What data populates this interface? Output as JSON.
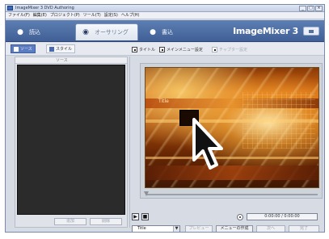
{
  "window": {
    "title": "ImageMixer 3 DVD Authoring",
    "controls": [
      "_",
      "□",
      "×"
    ]
  },
  "menu": [
    "ファイル(F)",
    "編集(E)",
    "プロジェクト(P)",
    "ツール(T)",
    "設定(S)",
    "ヘルプ(H)"
  ],
  "tabs": [
    {
      "label": "読込",
      "icon": "person-icon"
    },
    {
      "label": "オーサリング",
      "icon": "disc-person-icon",
      "active": true
    },
    {
      "label": "書込",
      "icon": "person-icon"
    }
  ],
  "brand": "ImageMixer 3",
  "toolbar": {
    "subtabs": [
      "ソース",
      "スタイル"
    ],
    "buttons": [
      "タイトル",
      "メインメニュー設定",
      "チャプター設定"
    ]
  },
  "left_panel": {
    "header": "ソース",
    "buttons": [
      "追加",
      "削除"
    ]
  },
  "preview": {
    "title_text": "Title"
  },
  "controls": {
    "timecode": "0:00:00 / 0:00:00"
  },
  "status": {
    "select_value": "Title",
    "buttons": [
      "プレビュー",
      "メニューの作成",
      "次へ",
      "完了"
    ]
  }
}
